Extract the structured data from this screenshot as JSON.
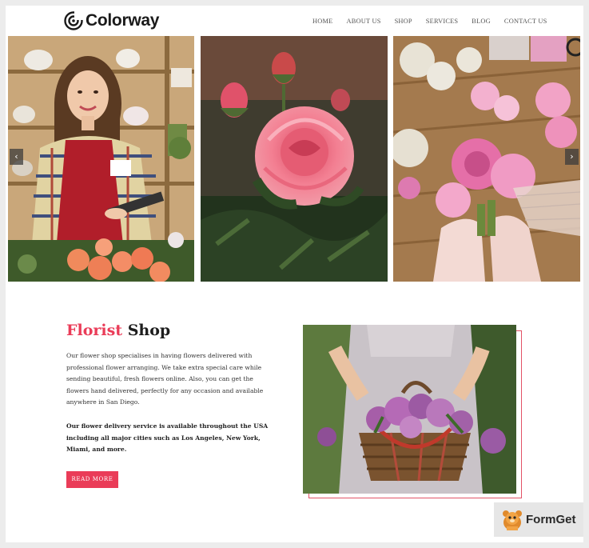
{
  "brand": {
    "name": "Colorway"
  },
  "nav": {
    "items": [
      "HOME",
      "ABOUT US",
      "SHOP",
      "SERVICES",
      "BLOG",
      "CONTACT US"
    ]
  },
  "slider": {
    "prev_icon": "chevron-left-icon",
    "next_icon": "chevron-right-icon",
    "prev_glyph": "‹",
    "next_glyph": "›"
  },
  "section": {
    "title_accent": "Florist",
    "title_rest": " Shop",
    "paragraph1": "Our flower shop specialises in having flowers delivered with professional flower arranging. We take extra special care while sending beautiful, fresh flowers online. Also, you can get the flowers hand delivered, perfectly for any occasion and available anywhere in San Diego.",
    "paragraph2": "Our flower delivery service is available throughout the USA including all major cities such as Los Angeles, New York, Miami, and more.",
    "button_label": "READ MORE"
  },
  "watermark": {
    "text": "FormGet"
  },
  "colors": {
    "accent": "#ea3c58",
    "frame": "#e25266",
    "background": "#ececec"
  }
}
